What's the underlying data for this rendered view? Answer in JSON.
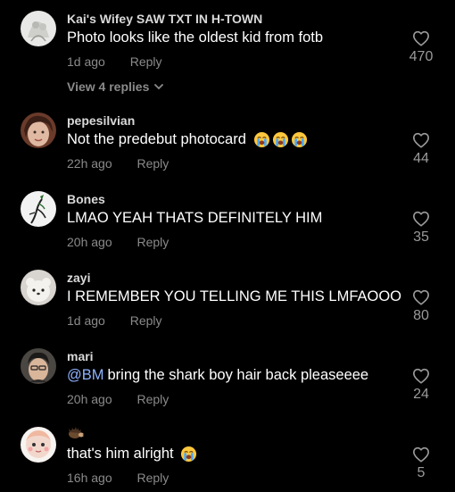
{
  "comments": [
    {
      "username": "Kai's Wifey SAW TXT IN H-TOWN",
      "text": "Photo looks like the oldest kid from fotb",
      "time": "1d ago",
      "reply_label": "Reply",
      "likes": "470",
      "view_replies": "View 4 replies"
    },
    {
      "username": "pepesilvian",
      "text": "Not the predebut photocard",
      "time": "22h ago",
      "reply_label": "Reply",
      "likes": "44"
    },
    {
      "username": "Bones",
      "text": "LMAO YEAH THATS DEFINITELY HIM",
      "time": "20h ago",
      "reply_label": "Reply",
      "likes": "35"
    },
    {
      "username": "zayi",
      "text": "I REMEMBER YOU TELLING ME THIS LMFAOOO",
      "time": "1d ago",
      "reply_label": "Reply",
      "likes": "80"
    },
    {
      "username": "mari",
      "mention": "@BM",
      "text": "bring the shark boy hair back pleaseeee",
      "time": "20h ago",
      "reply_label": "Reply",
      "likes": "24"
    },
    {
      "username": "",
      "text": "that's him alright",
      "time": "16h ago",
      "reply_label": "Reply",
      "likes": "5"
    }
  ],
  "icons": {
    "like": "heart-outline-icon",
    "expand": "chevron-down-icon",
    "emoji": "loudly-crying-face-emoji"
  },
  "colors": {
    "background": "#000000",
    "text": "#ffffff",
    "muted": "#8a8a8a",
    "mention": "#8fb3ff"
  }
}
